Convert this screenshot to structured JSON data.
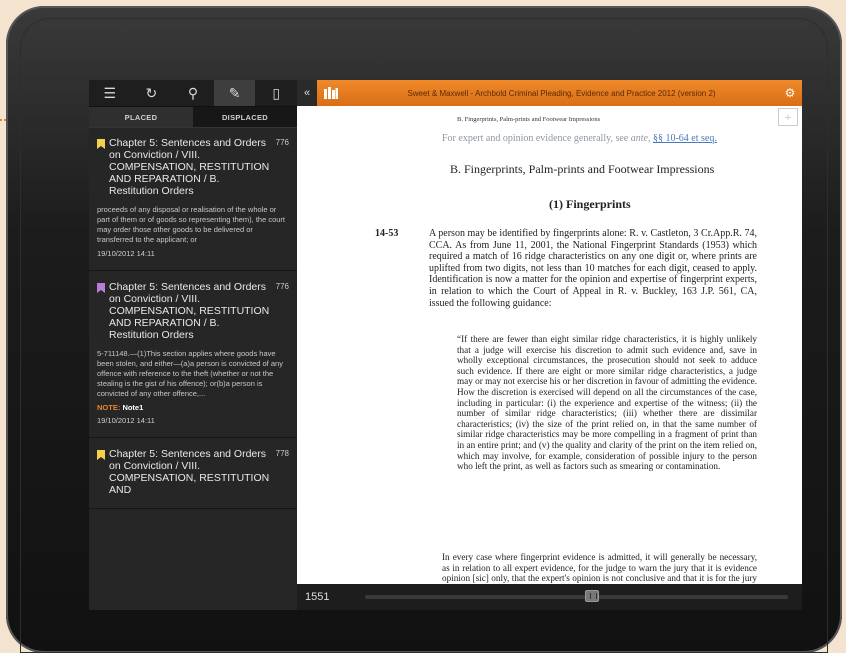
{
  "sidebar": {
    "toolbar": [
      {
        "name": "list-icon",
        "glyph": "☰"
      },
      {
        "name": "history-icon",
        "glyph": "↻"
      },
      {
        "name": "search-icon",
        "glyph": "⚲"
      },
      {
        "name": "annotation-icon",
        "glyph": "✎"
      },
      {
        "name": "bookmark-icon",
        "glyph": "▯"
      }
    ],
    "tabs": [
      "PLACED",
      "DISPLACED"
    ],
    "entries": [
      {
        "title": "Chapter 5: Sentences and Orders on Conviction / VIII. COMPENSATION, RESTITUTION AND REPARATION / B. Restitution Orders",
        "page": "776",
        "color": "#f2d24a",
        "body": "proceeds of any disposal or realisation of the whole or part of them or of goods so representing them), the court may order those other goods to be delivered or transferred to the applicant; or",
        "note_label": "",
        "note": "",
        "date": "19/10/2012 14:11"
      },
      {
        "title": "Chapter 5: Sentences and Orders on Conviction / VIII. COMPENSATION, RESTITUTION AND REPARATION / B. Restitution Orders",
        "page": "776",
        "color": "#b57fd6",
        "body": "5-711148.—(1)This section applies where goods have been stolen, and either—(a)a person is convicted of any offence with reference to the theft (whether or not the stealing is the gist of his offence); or(b)a person is convicted of any other offence,...",
        "note_label": "NOTE:",
        "note": "Note1",
        "date": "19/10/2012 14:11"
      },
      {
        "title": "Chapter 5: Sentences and Orders on Conviction / VIII. COMPENSATION, RESTITUTION AND",
        "page": "778",
        "color": "#f2d24a",
        "body": "",
        "note_label": "",
        "note": "",
        "date": ""
      }
    ]
  },
  "topbar": {
    "back_glyph": "«",
    "book_title": "Sweet & Maxwell - Archbold Criminal Pleading, Evidence and Practice 2012 (version 2)",
    "settings_glyph": "⚙",
    "plus_glyph": "+"
  },
  "document": {
    "running_head": "B. Fingerprints, Palm-prints and Footwear Impressions",
    "faded_line_pre": "For expert and opinion evidence generally, see",
    "faded_line_ante": "ante,",
    "faded_line_link": "§§ 10-64 et seq.",
    "section_heading": "B.   Fingerprints, Palm-prints and Footwear Impressions",
    "sub_heading": "(1) Fingerprints",
    "para_number": "14-53",
    "para_text": "A person may be identified by fingerprints alone: R. v. Castleton, 3 Cr.App.R. 74, CCA. As from June 11, 2001, the National Fingerprint Standards (1953) which required a match of 16 ridge characteristics on any one digit or, where prints are uplifted from two digits, not less than 10 matches for each digit, ceased to apply. Identification is now a matter for the opinion and expertise of fingerprint experts, in relation to which the Court of Appeal in R. v. Buckley, 163 J.P. 561, CA, issued the following guidance:",
    "quote_text": "“If there are fewer than eight similar ridge characteristics, it is highly unlikely that a judge will exercise his discretion to admit such evidence and, save in wholly exceptional circumstances, the prosecution should not seek to adduce such evidence. If there are eight or more similar ridge characteristics, a judge may or may not exercise his or her discretion in favour of admitting the evidence. How the discretion is exercised will depend on all the circumstances of the case, including in particular: (i) the experience and expertise of the witness; (ii) the number of similar ridge characteristics; (iii) whether there are dissimilar characteristics; (iv) the size of the print relied on, in that the same number of similar ridge characteristics may be more compelling in a fragment of print than in an entire print; and (v) the quality and clarity of the print on the item relied on, which may involve, for example, consideration of possible injury to the person who left the print, as well as factors such as smearing or contamination.",
    "para2_text": "In every case where fingerprint evidence is admitted, it will generally be necessary, as in relation to all expert evidence, for the judge to warn the jury that it is evidence opinion [sic] only, that the expert's opinion is not conclusive and that it is for the jury to determine"
  },
  "bottombar": {
    "page_number": "1551",
    "position": 0.52
  },
  "colors": {
    "accent": "#e8862c",
    "sidebar_bg": "#262626"
  }
}
